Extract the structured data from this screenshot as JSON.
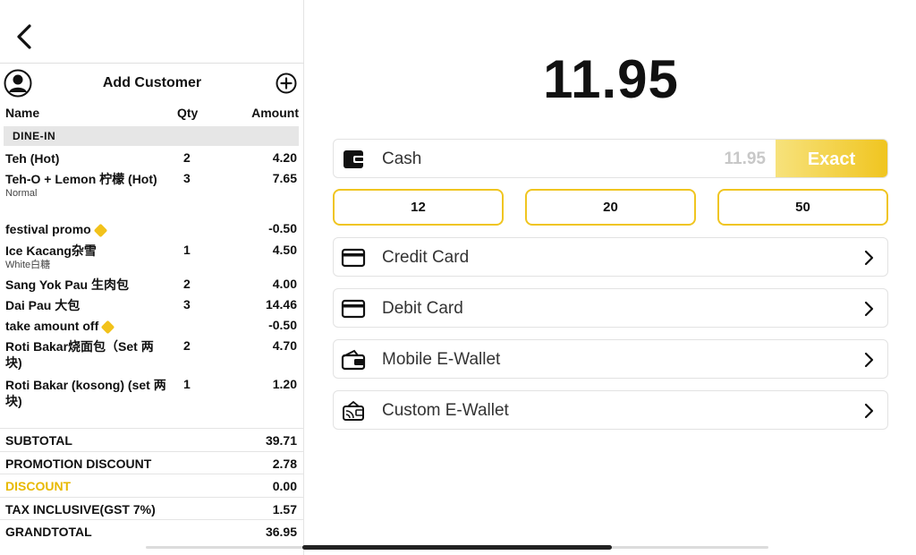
{
  "customer": {
    "label": "Add Customer"
  },
  "columns": {
    "name": "Name",
    "qty": "Qty",
    "amount": "Amount"
  },
  "section": "DINE-IN",
  "items": [
    {
      "name": "Teh (Hot)",
      "sub": "",
      "qty": "2",
      "amount": "4.20",
      "promo": false
    },
    {
      "name": "Teh-O + Lemon 柠檬 (Hot)",
      "sub": "Normal",
      "qty": "3",
      "amount": "7.65",
      "promo": false
    },
    {
      "name": "festival promo",
      "sub": "",
      "qty": "",
      "amount": "-0.50",
      "promo": true
    },
    {
      "name": "Ice Kacang杂雪",
      "sub": "White白糖",
      "qty": "1",
      "amount": "4.50",
      "promo": false
    },
    {
      "name": "Sang Yok Pau 生肉包",
      "sub": "",
      "qty": "2",
      "amount": "4.00",
      "promo": false
    },
    {
      "name": "Dai Pau 大包",
      "sub": "",
      "qty": "3",
      "amount": "14.46",
      "promo": false
    },
    {
      "name": "take amount off",
      "sub": "",
      "qty": "",
      "amount": "-0.50",
      "promo": true
    },
    {
      "name": "Roti Bakar烧面包（Set 两块)",
      "sub": "",
      "qty": "2",
      "amount": "4.70",
      "promo": false
    },
    {
      "name": "Roti Bakar (kosong) (set 两块)",
      "sub": "",
      "qty": "1",
      "amount": "1.20",
      "promo": false
    }
  ],
  "totals": [
    {
      "label": "SUBTOTAL",
      "value": "39.71"
    },
    {
      "label": "PROMOTION DISCOUNT",
      "value": "2.78"
    },
    {
      "label": "DISCOUNT",
      "value": "0.00"
    },
    {
      "label": "TAX INCLUSIVE(GST 7%)",
      "value": "1.57"
    },
    {
      "label": "GRANDTOTAL",
      "value": "36.95"
    }
  ],
  "payment": {
    "amount_due": "11.95",
    "cash": {
      "label": "Cash",
      "value": "11.95",
      "exact_label": "Exact"
    },
    "quick_amounts": [
      "12",
      "20",
      "50"
    ],
    "methods": [
      {
        "label": "Credit Card",
        "icon": "credit-card-icon"
      },
      {
        "label": "Debit Card",
        "icon": "debit-card-icon"
      },
      {
        "label": "Mobile E-Wallet",
        "icon": "wallet-icon"
      },
      {
        "label": "Custom E-Wallet",
        "icon": "custom-wallet-icon"
      }
    ]
  },
  "colors": {
    "accent": "#f0c520",
    "discount": "#e8b900"
  }
}
